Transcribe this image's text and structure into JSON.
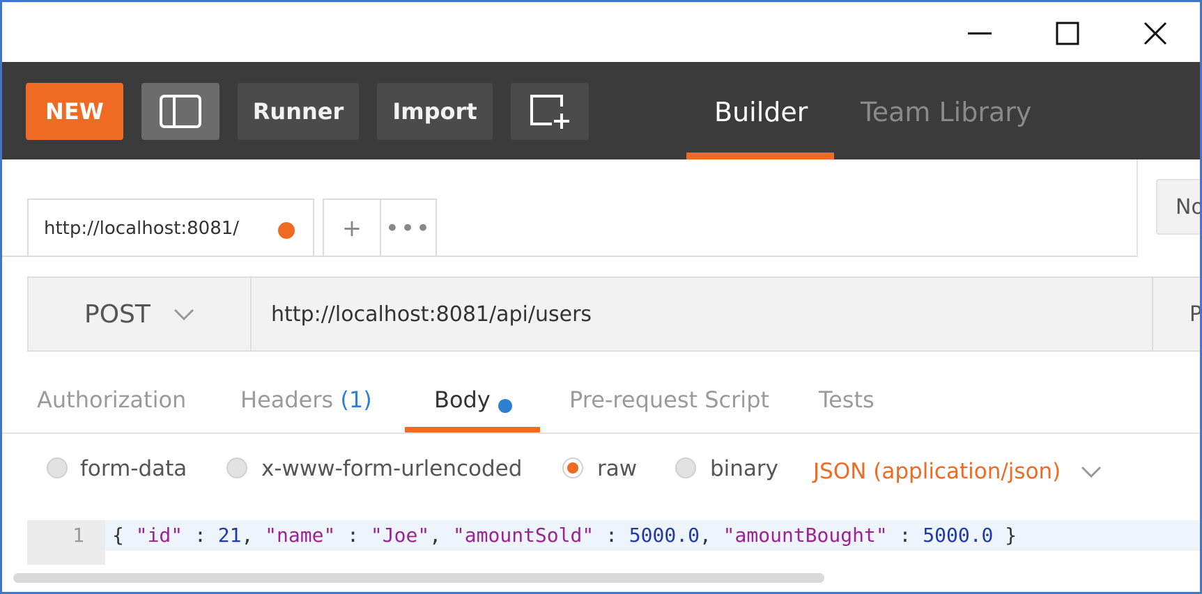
{
  "window": {
    "minimize_icon": "minimize-icon",
    "maximize_icon": "maximize-icon",
    "close_icon": "close-icon"
  },
  "toolbar": {
    "new_label": "NEW",
    "runner_label": "Runner",
    "import_label": "Import",
    "sidebar_icon": "sidebar-toggle-icon",
    "new_window_icon": "new-window-icon",
    "nav_tabs": [
      {
        "label": "Builder",
        "active": true
      },
      {
        "label": "Team Library",
        "active": false
      }
    ],
    "accent_color": "#ef6a22"
  },
  "request_tabs": {
    "active_tab_label": "http://localhost:8081/",
    "unsaved_indicator_color": "#ef6a22",
    "add_label": "+",
    "more_label": "•••",
    "environment_label": "No Environment"
  },
  "request": {
    "method": "POST",
    "url": "http://localhost:8081/api/users",
    "params_label": "Params"
  },
  "sub_tabs": {
    "authorization": "Authorization",
    "headers": "Headers",
    "headers_count": "(1)",
    "body": "Body",
    "prerequest": "Pre-request Script",
    "tests": "Tests",
    "active": "Body"
  },
  "body_type": {
    "options": [
      "form-data",
      "x-www-form-urlencoded",
      "raw",
      "binary"
    ],
    "selected": "raw",
    "content_type": "JSON (application/json)"
  },
  "editor": {
    "line_number": "1",
    "code": {
      "open": "{ ",
      "k1": "\"id\"",
      "sep1": " : ",
      "v1": "21",
      "c1": ", ",
      "k2": "\"name\"",
      "sep2": " : ",
      "v2": "\"Joe\"",
      "c2": ", ",
      "k3": "\"amountSold\"",
      "sep3": " : ",
      "v3": "5000.0",
      "c3": ", ",
      "k4": "\"amountBought\"",
      "sep4": " : ",
      "v4": "5000.0",
      "close": " }"
    }
  }
}
